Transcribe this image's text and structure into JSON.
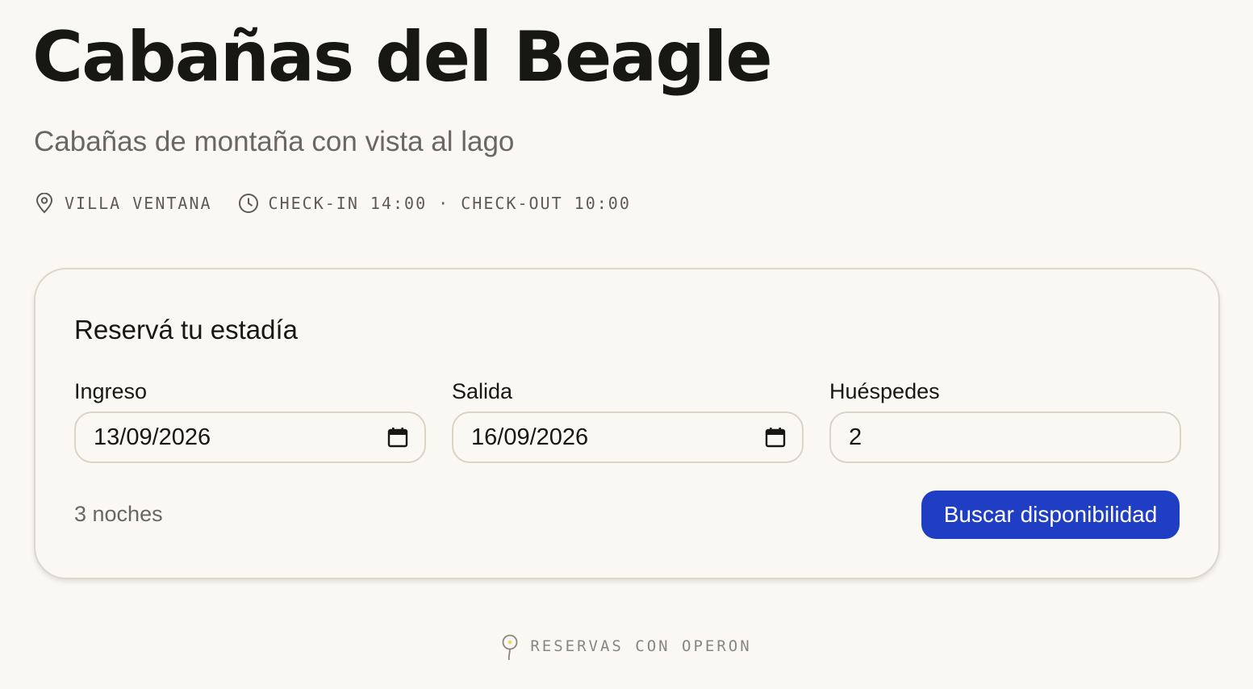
{
  "header": {
    "title": "Cabañas del Beagle",
    "subtitle": "Cabañas de montaña con vista al lago"
  },
  "meta": {
    "location": "VILLA VENTANA",
    "location_icon": "map-pin-icon",
    "schedule": "CHECK-IN 14:00 · CHECK-OUT 10:00",
    "schedule_icon": "clock-icon"
  },
  "booking": {
    "title": "Reservá tu estadía",
    "checkin": {
      "label": "Ingreso",
      "value": "13/09/2026",
      "icon": "calendar-icon"
    },
    "checkout": {
      "label": "Salida",
      "value": "16/09/2026",
      "icon": "calendar-icon"
    },
    "guests": {
      "label": "Huéspedes",
      "value": "2"
    },
    "nights": "3 noches",
    "search_label": "Buscar disponibilidad"
  },
  "footer": {
    "text": "RESERVAS CON OPERON",
    "icon": "pin-logo-icon"
  },
  "colors": {
    "background": "#faf8f2",
    "accent": "#1f3ec4",
    "text": "#171714",
    "muted": "#6b675f",
    "border": "#d9d4c6"
  }
}
